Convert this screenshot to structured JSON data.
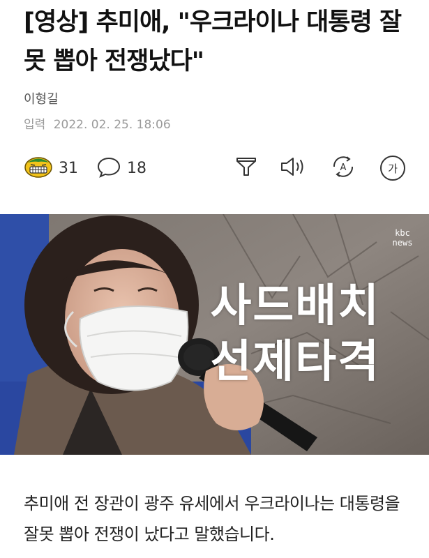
{
  "article": {
    "headline": "[영상] 추미애, \"우크라이나 대통령 잘못 뽑아 전쟁났다\"",
    "author": "이형길",
    "date_label": "입력",
    "date_value": "2022. 02. 25. 18:06"
  },
  "toolbar": {
    "reaction_count": "31",
    "comment_count": "18",
    "icons": [
      "reaction-emoji-icon",
      "comment-icon",
      "filter-icon",
      "speaker-icon",
      "translate-icon",
      "font-size-icon"
    ],
    "font_size_glyph": "가",
    "translate_glyph": "A"
  },
  "hero": {
    "caption_line1": "사드배치",
    "caption_line2": "선제타격",
    "logo_top": "kbc",
    "logo_bottom": "news"
  },
  "body": {
    "paragraph": "추미애 전 장관이 광주 유세에서 우크라이나는 대통령을 잘못 뽑아 전쟁이 났다고 말했습니다."
  }
}
